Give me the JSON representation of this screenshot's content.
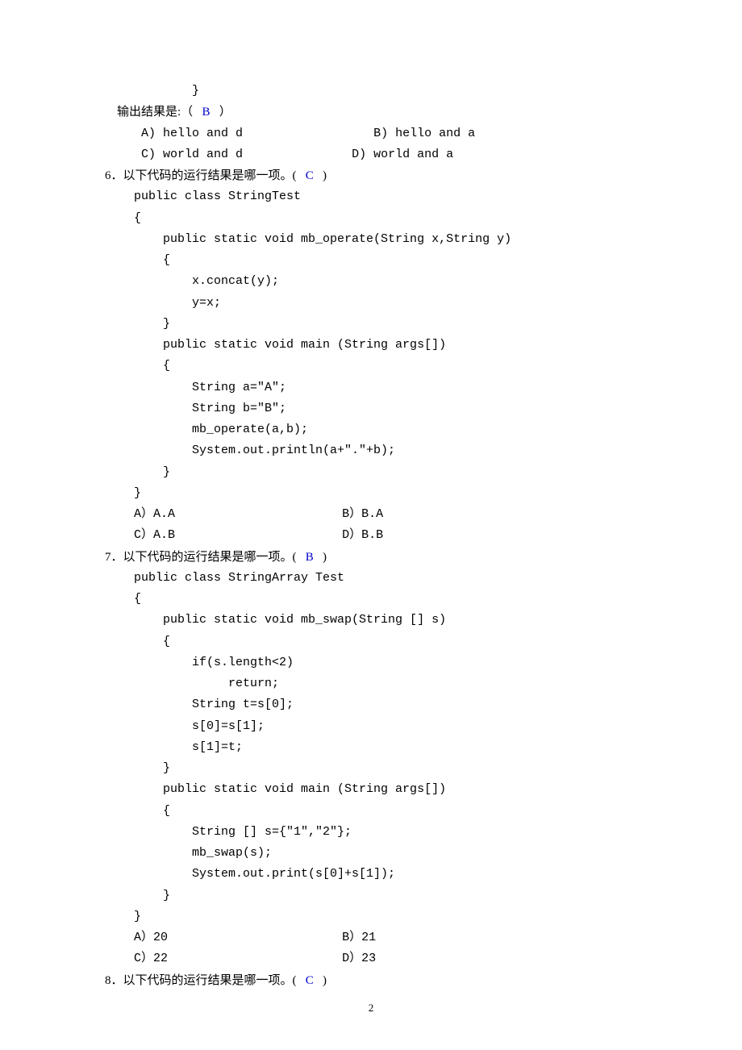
{
  "frag": {
    "closeBrace": "            }",
    "resultLabel": "    输出结果是:",
    "openParen": "（",
    "closeParen": "）",
    "ans5": "B",
    "q5optA": "     A) hello and d",
    "q5optB": "B) hello and a",
    "q5optC": "     C) world and d",
    "q5optD": "D) world and a"
  },
  "q6": {
    "stem": "6．以下代码的运行结果是哪一项。(",
    "ans": "C",
    "close": ")",
    "code1": "    public class StringTest",
    "code2": "    {",
    "code3": "        public static void mb_operate(String x,String y)",
    "code4": "        {",
    "code5": "            x.concat(y);",
    "code6": "            y=x;",
    "code7": "        }",
    "code8": "        public static void main (String args[])",
    "code9": "        {",
    "code10": "            String a=\"A\";",
    "code11": "            String b=\"B\";",
    "code12": "            mb_operate(a,b);",
    "code13": "            System.out.println(a+\".\"+b);",
    "code14": "        }",
    "code15": "    }",
    "optA": "    A）A.A",
    "optB": "B）B.A",
    "optC": "    C）A.B",
    "optD": "D）B.B"
  },
  "q7": {
    "stem": "7．以下代码的运行结果是哪一项。(",
    "ans": "B",
    "close": ")",
    "code1": "    public class StringArray Test",
    "code2": "    {",
    "code3": "        public static void mb_swap(String [] s)",
    "code4": "        {",
    "code5": "            if(s.length<2)",
    "code6": "                 return;",
    "code7": "            String t=s[0];",
    "code8": "            s[0]=s[1];",
    "code9": "            s[1]=t;",
    "code10": "        }",
    "code11": "        public static void main (String args[])",
    "code12": "        {",
    "code13": "            String [] s={\"1\",\"2\"};",
    "code14": "            mb_swap(s);",
    "code15": "            System.out.print(s[0]+s[1]);",
    "code16": "        }",
    "code17": "    }",
    "optA": "    A）20",
    "optB": "B）21",
    "optC": "    C）22",
    "optD": "D）23"
  },
  "q8": {
    "stem": "8．以下代码的运行结果是哪一项。(",
    "ans": "C",
    "close": ")"
  },
  "pageNumber": "2"
}
